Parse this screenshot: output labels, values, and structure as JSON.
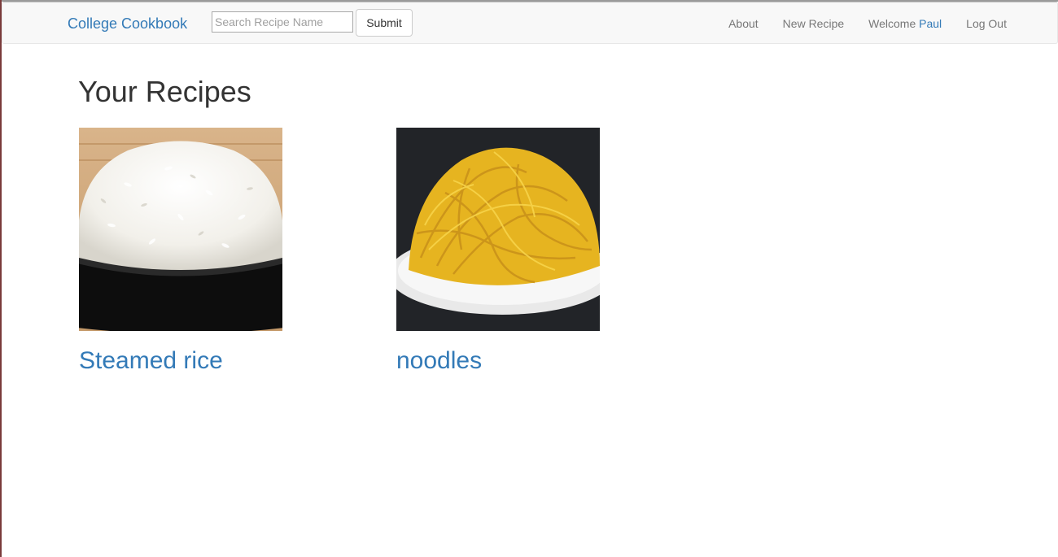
{
  "navbar": {
    "brand": "College Cookbook",
    "search": {
      "placeholder": "Search Recipe Name",
      "value": ""
    },
    "submit_label": "Submit",
    "links": {
      "about": "About",
      "new_recipe": "New Recipe",
      "welcome_prefix": "Welcome",
      "username": "Paul",
      "logout": "Log Out"
    }
  },
  "page": {
    "title": "Your Recipes"
  },
  "recipes": [
    {
      "name": "Steamed rice",
      "image": "rice-bowl-photo"
    },
    {
      "name": "noodles",
      "image": "noodles-plate-photo"
    }
  ],
  "colors": {
    "link": "#337ab7",
    "navbar_bg": "#f8f8f8",
    "nav_text": "#777777"
  }
}
